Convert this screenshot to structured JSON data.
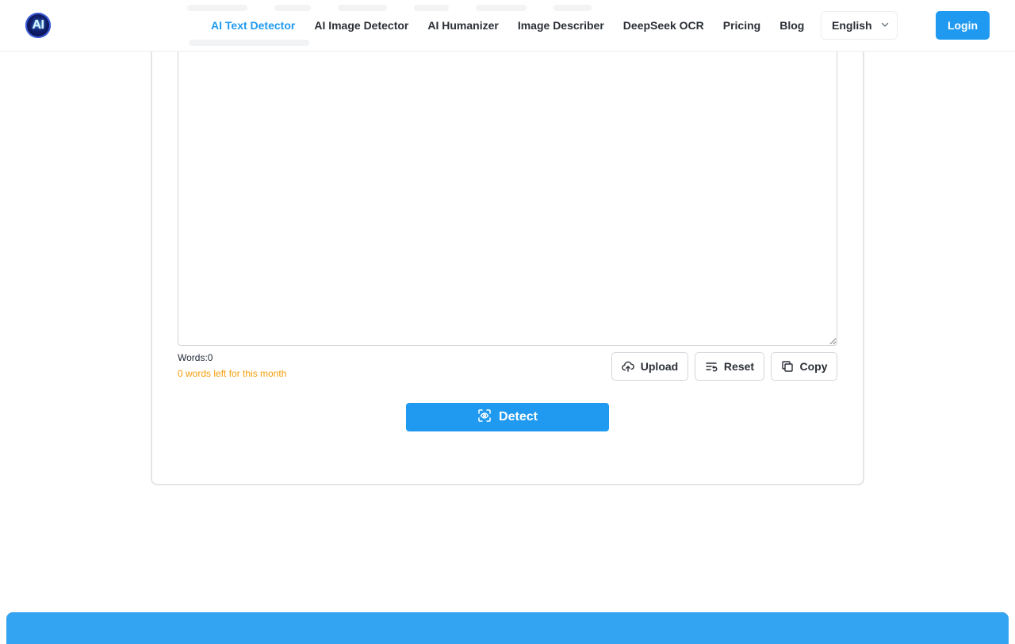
{
  "header": {
    "logo_text": "AI",
    "nav": [
      {
        "label": "AI Text Detector",
        "active": true
      },
      {
        "label": "AI Image Detector"
      },
      {
        "label": "AI Humanizer"
      },
      {
        "label": "Image Describer"
      },
      {
        "label": "DeepSeek OCR"
      },
      {
        "label": "Pricing"
      },
      {
        "label": "Blog"
      }
    ],
    "language": "English",
    "login_label": "Login"
  },
  "editor": {
    "text_value": "",
    "word_count": "Words:0",
    "words_left": "0 words left for this month",
    "upload_label": "Upload",
    "reset_label": "Reset",
    "copy_label": "Copy",
    "detect_label": "Detect"
  },
  "colors": {
    "accent": "#1f9af0",
    "warning": "#f59e0b",
    "banner": "#33a4f2"
  }
}
